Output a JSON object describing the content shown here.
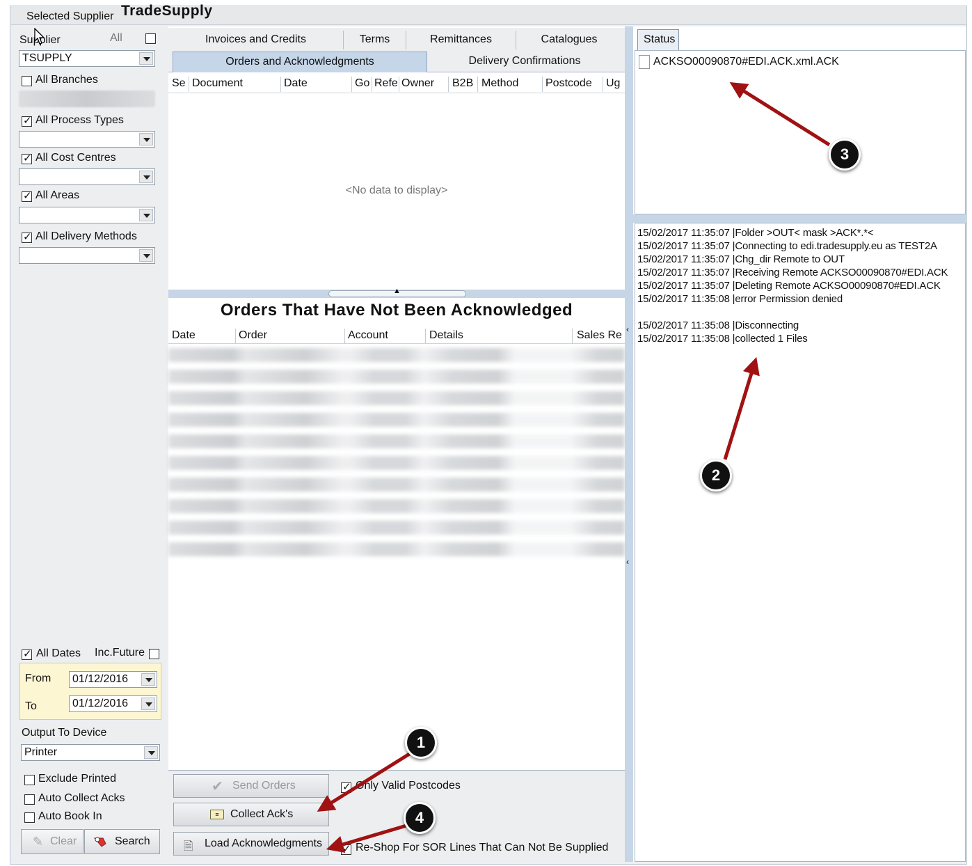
{
  "header": {
    "selected_supplier_label": "Selected Supplier",
    "selected_supplier_value": "TradeSupply"
  },
  "filters": {
    "supplier_label": "Supplier",
    "all_label": "All",
    "supplier_value": "TSUPPLY",
    "all_branches": "All Branches",
    "all_process_types": "All Process Types",
    "all_cost_centres": "All Cost Centres",
    "all_areas": "All Areas",
    "all_delivery_methods": "All Delivery Methods",
    "all_dates": "All Dates",
    "inc_future": "Inc.Future",
    "from_label": "From",
    "from_value": "01/12/2016",
    "to_label": "To",
    "to_value": "01/12/2016",
    "output_to_device_label": "Output To Device",
    "output_device_value": "Printer",
    "exclude_printed": "Exclude Printed",
    "auto_collect_acks": "Auto Collect Acks",
    "auto_book_in": "Auto Book In",
    "clear_button": "Clear",
    "search_button": "Search"
  },
  "tabs": {
    "row1": [
      "Invoices and Credits",
      "Terms",
      "Remittances",
      "Catalogues"
    ],
    "row2": [
      "Orders and Acknowledgments",
      "Delivery Confirmations"
    ]
  },
  "grid": {
    "columns": [
      "Se",
      "Document",
      "Date",
      "Go",
      "Refe",
      "Owner",
      "B2B",
      "Method",
      "Postcode",
      "Ug"
    ],
    "empty_text": "<No data to display>"
  },
  "unacknowledged": {
    "title": "Orders That Have Not Been Acknowledged",
    "columns": [
      "Date",
      "Order",
      "Account",
      "Details",
      "Sales Re"
    ]
  },
  "actions": {
    "send_orders": "Send Orders",
    "collect_acks": "Collect Ack's",
    "load_acknowledgments": "Load Acknowledgments",
    "only_valid_postcodes": "Only Valid Postcodes",
    "reshop": "Re-Shop For SOR Lines That Can Not Be Supplied"
  },
  "status": {
    "tab_label": "Status",
    "file_item": "ACKSO00090870#EDI.ACK.xml.ACK"
  },
  "log": [
    "15/02/2017 11:35:07 |Folder >OUT< mask >ACK*.*<",
    "15/02/2017 11:35:07 |Connecting to edi.tradesupply.eu as TEST2A",
    "15/02/2017 11:35:07 |Chg_dir Remote to OUT",
    "15/02/2017 11:35:07 |Receiving Remote ACKSO00090870#EDI.ACK",
    "15/02/2017 11:35:07 |Deleting Remote ACKSO00090870#EDI.ACK",
    "15/02/2017 11:35:08 |error Permission denied",
    "",
    "15/02/2017 11:35:08 |Disconnecting",
    "15/02/2017 11:35:08 |collected 1 Files"
  ],
  "annotations": [
    "1",
    "2",
    "3",
    "4"
  ],
  "colors": {
    "accent": "#c7d6e6",
    "arrow": "#a01212",
    "active_tab": "#c5d6e8"
  }
}
